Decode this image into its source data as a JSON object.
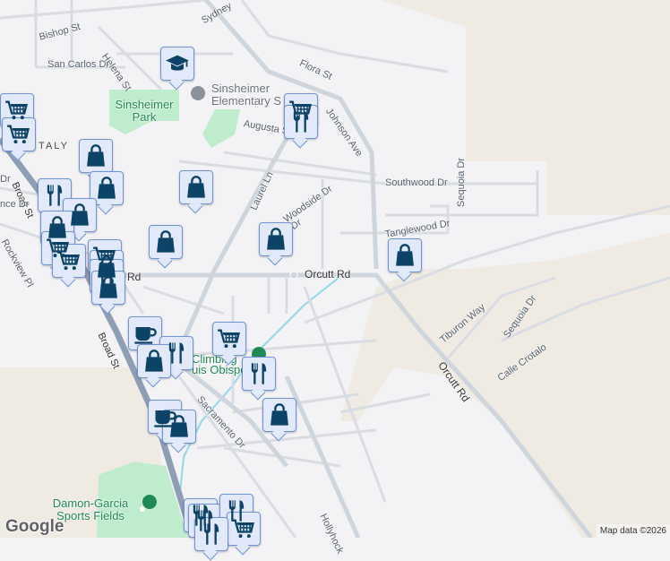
{
  "streets": {
    "sydney": "Sydney",
    "bishop": "Bishop St",
    "helena": "Helena St",
    "san_carlos": "San Carlos Dr",
    "flora": "Flora St",
    "augusta": "Augusta St",
    "johnson": "Johnson Ave",
    "laurel": "Laurel Ln",
    "southwood": "Southwood Dr",
    "sequoia_top": "Sequoia Dr",
    "tanglewood": "Tanglewood Dr",
    "woodside": "Woodside Dr",
    "fe_dr": "Dr",
    "orcutt_left": "Rd",
    "orcutt_center": "Orcutt Rd",
    "orcutt_diag": "Orcutt Rd",
    "tiburon": "Tiburon Way",
    "sequoia_bottom": "Sequoia Dr",
    "calle_crotalo": "Calle Crotalo",
    "broad_top": "Broad St",
    "broad_bottom": "Broad St",
    "rockview": "Rockview Pl",
    "nce_dr": "nce Dr",
    "dr_left": "Dr",
    "sacramento": "Sacramento Dr",
    "hollyhock": "Hollyhock"
  },
  "places": {
    "sinsheimer_school": "Sinsheimer Elementary S",
    "sinsheimer_park": "Sinsheimer Park",
    "italy": "ITALY",
    "climbing": "Climbing",
    "obispo": "uis Obispo",
    "damon_garcia": "Damon-Garcia Sports Fields"
  },
  "markers": [
    "school",
    "cart",
    "cart",
    "cart",
    "restaurant",
    "shopping",
    "shopping",
    "shopping",
    "restaurant",
    "shopping",
    "shopping",
    "shopping",
    "shopping",
    "shopping",
    "cart",
    "cart",
    "cart",
    "shopping",
    "restaurant",
    "shopping",
    "cafe",
    "restaurant",
    "shopping",
    "cart",
    "restaurant",
    "shopping",
    "cafe",
    "shopping",
    "restaurant",
    "restaurant",
    "restaurant",
    "cart",
    "restaurant"
  ],
  "branding": {
    "logo": "Google",
    "attribution": "Map data ©2026"
  },
  "colors": {
    "marker_bg": "#e1e9fb",
    "marker_border": "#6f93d9",
    "icon": "#0d4366",
    "park": "#bfeccd",
    "terrain": "#efebe2",
    "highway": "#8e9fb5"
  }
}
